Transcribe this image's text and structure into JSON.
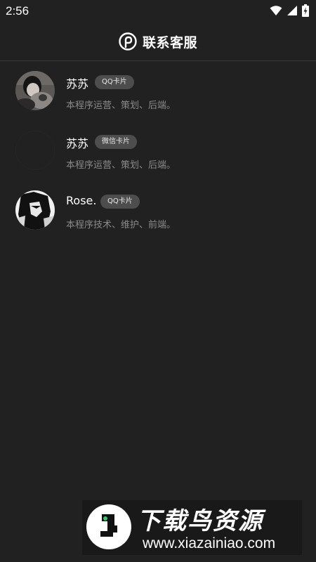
{
  "status_bar": {
    "time": "2:56",
    "icons": [
      "wifi-icon",
      "signal-icon",
      "battery-charging-icon"
    ]
  },
  "header": {
    "title": "联系客服",
    "logo_icon": "brand-logo-icon"
  },
  "contacts": [
    {
      "name": "苏苏",
      "badge": "QQ卡片",
      "description": "本程序运营、策划、后端。",
      "avatar": "avatar-photo-cat"
    },
    {
      "name": "苏苏",
      "badge": "微信卡片",
      "description": "本程序运营、策划、后端。",
      "avatar": "avatar-empty"
    },
    {
      "name": "Rose.",
      "badge": "QQ卡片",
      "description": "本程序技术、维护、前端。",
      "avatar": "avatar-anime-bw"
    }
  ],
  "watermark": {
    "title": "下载鸟资源",
    "url": "www.xiazainiao.com"
  },
  "colors": {
    "background": "#212121",
    "badge_bg": "#4d4d4d",
    "desc_text": "#8a8a8a"
  }
}
